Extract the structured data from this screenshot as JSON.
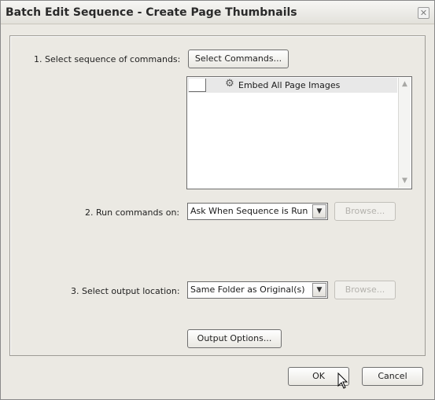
{
  "window": {
    "title": "Batch Edit Sequence - Create Page Thumbnails",
    "close_glyph": "✕"
  },
  "step1": {
    "label": "1. Select sequence of commands:",
    "button": "Select Commands...",
    "commands": [
      {
        "label": "Embed All Page Images",
        "icon": "gear-icon"
      }
    ]
  },
  "step2": {
    "label": "2. Run commands on:",
    "selected": "Ask When Sequence is Run",
    "browse": "Browse..."
  },
  "step3": {
    "label": "3. Select output location:",
    "selected": "Same Folder as Original(s)",
    "browse": "Browse..."
  },
  "output_options": "Output Options...",
  "footer": {
    "ok": "OK",
    "cancel": "Cancel"
  }
}
